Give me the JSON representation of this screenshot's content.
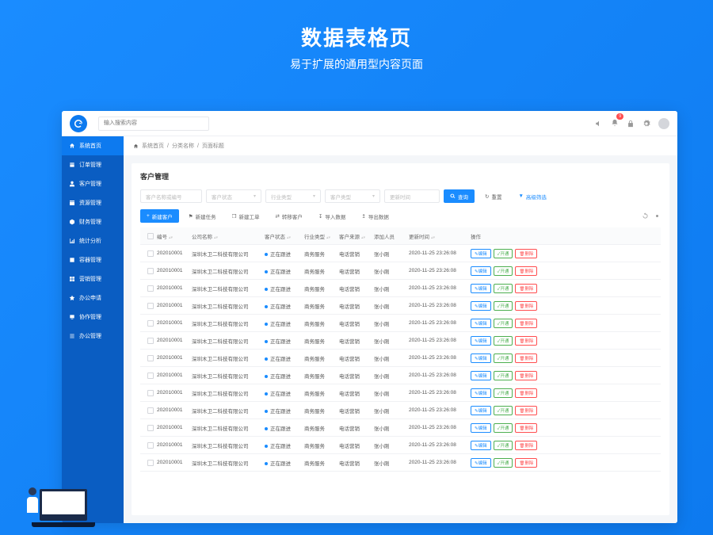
{
  "hero": {
    "title": "数据表格页",
    "subtitle": "易于扩展的通用型内容页面"
  },
  "topbar": {
    "search_placeholder": "输入搜索内容",
    "notif_count": "9"
  },
  "sidebar": {
    "items": [
      {
        "label": "系统首页"
      },
      {
        "label": "订单管理"
      },
      {
        "label": "客户管理"
      },
      {
        "label": "资源管理"
      },
      {
        "label": "财务管理"
      },
      {
        "label": "统计分析"
      },
      {
        "label": "容器管理"
      },
      {
        "label": "营销管理"
      },
      {
        "label": "办公申请"
      },
      {
        "label": "协作管理"
      },
      {
        "label": "办公管理"
      }
    ]
  },
  "breadcrumb": {
    "p1": "系统首页",
    "p2": "分类名称",
    "p3": "页面标题"
  },
  "panel": {
    "title": "客户管理"
  },
  "filters": {
    "f1": "客户名称或编号",
    "f2": "客户状态",
    "f3": "行业类型",
    "f4": "客户类型",
    "f5": "更新时间",
    "search": "查询",
    "reset": "重置",
    "advanced": "高级筛选"
  },
  "actions": {
    "new": "新建客户",
    "a1": "新建任务",
    "a2": "新建工单",
    "a3": "转移客户",
    "a4": "导入数据",
    "a5": "导出数据"
  },
  "table": {
    "headers": {
      "c1": "编号",
      "c2": "公司名称",
      "c3": "客户状态",
      "c4": "行业类型",
      "c5": "客户来源",
      "c6": "添加人员",
      "c7": "更新时间",
      "c8": "操作"
    },
    "ops": {
      "edit": "编辑",
      "open": "开通",
      "del": "删除"
    },
    "rows": [
      {
        "no": "202010001",
        "company": "深圳木卫二科技有限公司",
        "status": "正在跟进",
        "industry": "商务服务",
        "source": "电话营销",
        "adder": "张小刚",
        "updated": "2020-11-25 23:26:08"
      },
      {
        "no": "202010001",
        "company": "深圳木卫二科技有限公司",
        "status": "正在跟进",
        "industry": "商务服务",
        "source": "电话营销",
        "adder": "张小刚",
        "updated": "2020-11-25 23:26:08"
      },
      {
        "no": "202010001",
        "company": "深圳木卫二科技有限公司",
        "status": "正在跟进",
        "industry": "商务服务",
        "source": "电话营销",
        "adder": "张小刚",
        "updated": "2020-11-25 23:26:08"
      },
      {
        "no": "202010001",
        "company": "深圳木卫二科技有限公司",
        "status": "正在跟进",
        "industry": "商务服务",
        "source": "电话营销",
        "adder": "张小刚",
        "updated": "2020-11-25 23:26:08"
      },
      {
        "no": "202010001",
        "company": "深圳木卫二科技有限公司",
        "status": "正在跟进",
        "industry": "商务服务",
        "source": "电话营销",
        "adder": "张小刚",
        "updated": "2020-11-25 23:26:08"
      },
      {
        "no": "202010001",
        "company": "深圳木卫二科技有限公司",
        "status": "正在跟进",
        "industry": "商务服务",
        "source": "电话营销",
        "adder": "张小刚",
        "updated": "2020-11-25 23:26:08"
      },
      {
        "no": "202010001",
        "company": "深圳木卫二科技有限公司",
        "status": "正在跟进",
        "industry": "商务服务",
        "source": "电话营销",
        "adder": "张小刚",
        "updated": "2020-11-25 23:26:08"
      },
      {
        "no": "202010001",
        "company": "深圳木卫二科技有限公司",
        "status": "正在跟进",
        "industry": "商务服务",
        "source": "电话营销",
        "adder": "张小刚",
        "updated": "2020-11-25 23:26:08"
      },
      {
        "no": "202010001",
        "company": "深圳木卫二科技有限公司",
        "status": "正在跟进",
        "industry": "商务服务",
        "source": "电话营销",
        "adder": "张小刚",
        "updated": "2020-11-25 23:26:08"
      },
      {
        "no": "202010001",
        "company": "深圳木卫二科技有限公司",
        "status": "正在跟进",
        "industry": "商务服务",
        "source": "电话营销",
        "adder": "张小刚",
        "updated": "2020-11-25 23:26:08"
      },
      {
        "no": "202010001",
        "company": "深圳木卫二科技有限公司",
        "status": "正在跟进",
        "industry": "商务服务",
        "source": "电话营销",
        "adder": "张小刚",
        "updated": "2020-11-25 23:26:08"
      },
      {
        "no": "202010001",
        "company": "深圳木卫二科技有限公司",
        "status": "正在跟进",
        "industry": "商务服务",
        "source": "电话营销",
        "adder": "张小刚",
        "updated": "2020-11-25 23:26:08"
      },
      {
        "no": "202010001",
        "company": "深圳木卫二科技有限公司",
        "status": "正在跟进",
        "industry": "商务服务",
        "source": "电话营销",
        "adder": "张小刚",
        "updated": "2020-11-25 23:26:08"
      }
    ]
  }
}
